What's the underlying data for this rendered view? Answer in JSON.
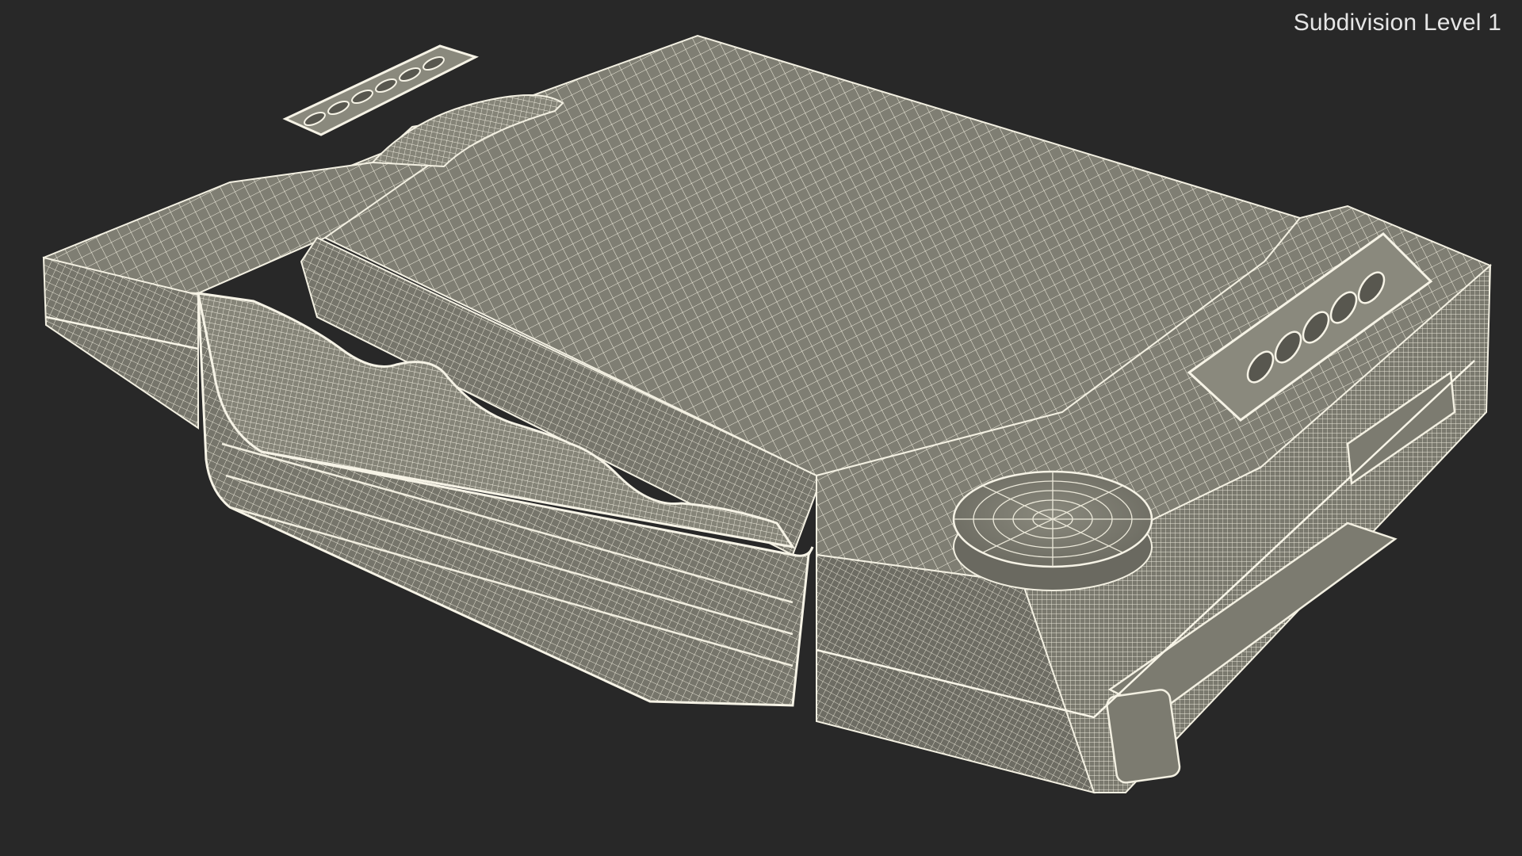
{
  "viewport": {
    "label": "Subdivision Level 1",
    "background_color": "#282828",
    "model_color": "#7d7c71",
    "wire_color": "#e9e6d6"
  }
}
